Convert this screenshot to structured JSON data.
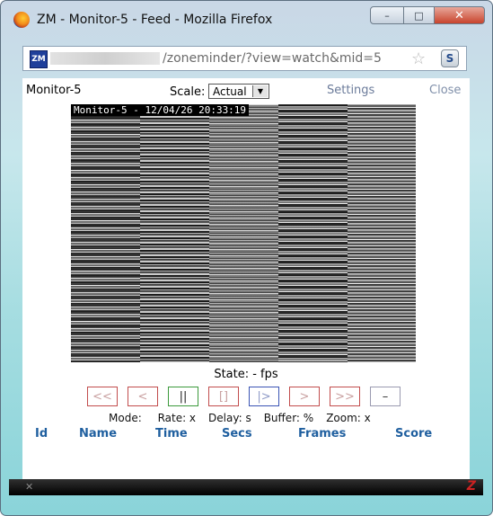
{
  "window": {
    "title": "ZM - Monitor-5 - Feed - Mozilla Firefox",
    "minimize": "–",
    "maximize": "□",
    "close": "✕"
  },
  "urlbar": {
    "badge": "ZM",
    "url": "/zoneminder/?view=watch&mid=5",
    "star": "☆",
    "s_button": "S"
  },
  "header": {
    "monitor_name": "Monitor-5",
    "scale_label": "Scale:",
    "scale_value": "Actual",
    "settings": "Settings",
    "close": "Close"
  },
  "feed": {
    "timestamp": "Monitor-5 - 12/04/26 20:33:19"
  },
  "state": "State:  -  fps",
  "controls": [
    {
      "label": "<<",
      "name": "fast-rewind-button",
      "color": "red"
    },
    {
      "label": "<",
      "name": "slow-rewind-button",
      "color": "red"
    },
    {
      "label": "||",
      "name": "pause-button",
      "color": "green"
    },
    {
      "label": "[]",
      "name": "stop-button",
      "color": "red"
    },
    {
      "label": "|>",
      "name": "play-button",
      "color": "blue"
    },
    {
      "label": ">",
      "name": "slow-forward-button",
      "color": "red"
    },
    {
      "label": ">>",
      "name": "fast-forward-button",
      "color": "red"
    },
    {
      "label": "–",
      "name": "zoom-out-button",
      "color": "gray"
    }
  ],
  "status": {
    "mode": "Mode: ",
    "rate": "Rate: x",
    "delay": "Delay: s",
    "buffer": "Buffer: %",
    "zoom": "Zoom: x"
  },
  "events_header": {
    "id": "Id",
    "name": "Name",
    "time": "Time",
    "secs": "Secs",
    "frames": "Frames",
    "score": "Score"
  },
  "statusbar": {
    "x": "✕",
    "z": "Z"
  }
}
